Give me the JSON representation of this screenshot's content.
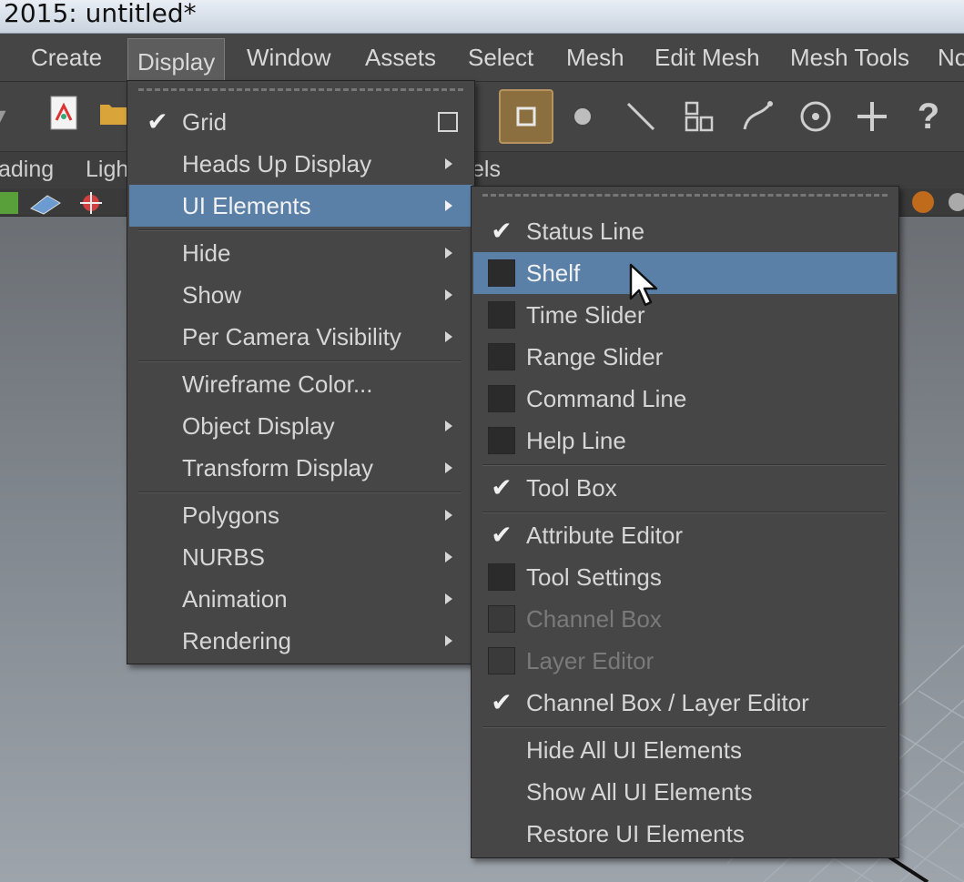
{
  "window": {
    "title": "2015: untitled*"
  },
  "menubar": {
    "items": [
      "Create",
      "Display",
      "Window",
      "Assets",
      "Select",
      "Mesh",
      "Edit Mesh",
      "Mesh Tools",
      "No"
    ],
    "active": "Display"
  },
  "shelf": {
    "tabs": [
      "ading",
      "Ligh",
      "els"
    ]
  },
  "display_menu": {
    "grid": "Grid",
    "heads_up": "Heads Up Display",
    "ui_elements": "UI Elements",
    "hide": "Hide",
    "show": "Show",
    "per_camera": "Per Camera Visibility",
    "wireframe_color": "Wireframe Color...",
    "object_display": "Object Display",
    "transform_display": "Transform Display",
    "polygons": "Polygons",
    "nurbs": "NURBS",
    "animation": "Animation",
    "rendering": "Rendering"
  },
  "ui_submenu": {
    "status_line": "Status Line",
    "shelf": "Shelf",
    "time_slider": "Time Slider",
    "range_slider": "Range Slider",
    "command_line": "Command Line",
    "help_line": "Help Line",
    "tool_box": "Tool Box",
    "attribute_editor": "Attribute Editor",
    "tool_settings": "Tool Settings",
    "channel_box": "Channel Box",
    "layer_editor": "Layer Editor",
    "channel_box_layer_editor": "Channel Box / Layer Editor",
    "hide_all": "Hide All UI Elements",
    "show_all": "Show All UI Elements",
    "restore": "Restore UI Elements"
  },
  "toolbar": {
    "help_glyph": "?"
  },
  "colors": {
    "highlight": "#5b80a8",
    "selected_tool": "#8b6f3f",
    "menu_bg": "#464646"
  }
}
